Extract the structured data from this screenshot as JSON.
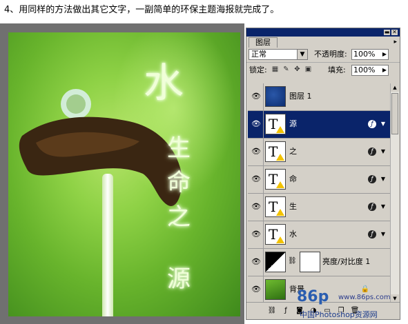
{
  "caption": "4、用同样的方法做出其它文字，一副简单的环保主题海报就完成了。",
  "poster": {
    "title_char": "水",
    "vertical_chars": [
      "生",
      "命",
      "之",
      "源"
    ]
  },
  "layers_panel": {
    "tab_label": "图层",
    "blend_mode": "正常",
    "opacity_label": "不透明度:",
    "opacity_value": "100%",
    "lock_label": "锁定:",
    "fill_label": "填充:",
    "fill_value": "100%",
    "layers": [
      {
        "name": "图层 1",
        "type": "pixel",
        "selected": false
      },
      {
        "name": "源",
        "type": "text",
        "selected": true
      },
      {
        "name": "之",
        "type": "text",
        "selected": false
      },
      {
        "name": "命",
        "type": "text",
        "selected": false
      },
      {
        "name": "生",
        "type": "text",
        "selected": false
      },
      {
        "name": "水",
        "type": "text",
        "selected": false
      },
      {
        "name": "亮度/对比度 1",
        "type": "adjustment",
        "selected": false
      },
      {
        "name": "背景",
        "type": "background",
        "selected": false
      }
    ],
    "text_thumb_glyph": "T",
    "fx_glyph": "ƒ"
  },
  "watermark": {
    "logo": "86p",
    "url": "www.86ps.com",
    "site_name": "中国Photoshop资源网"
  },
  "colors": {
    "selection": "#0a246a",
    "panel_bg": "#d4d0c8",
    "poster_green": "#7cc43a"
  }
}
